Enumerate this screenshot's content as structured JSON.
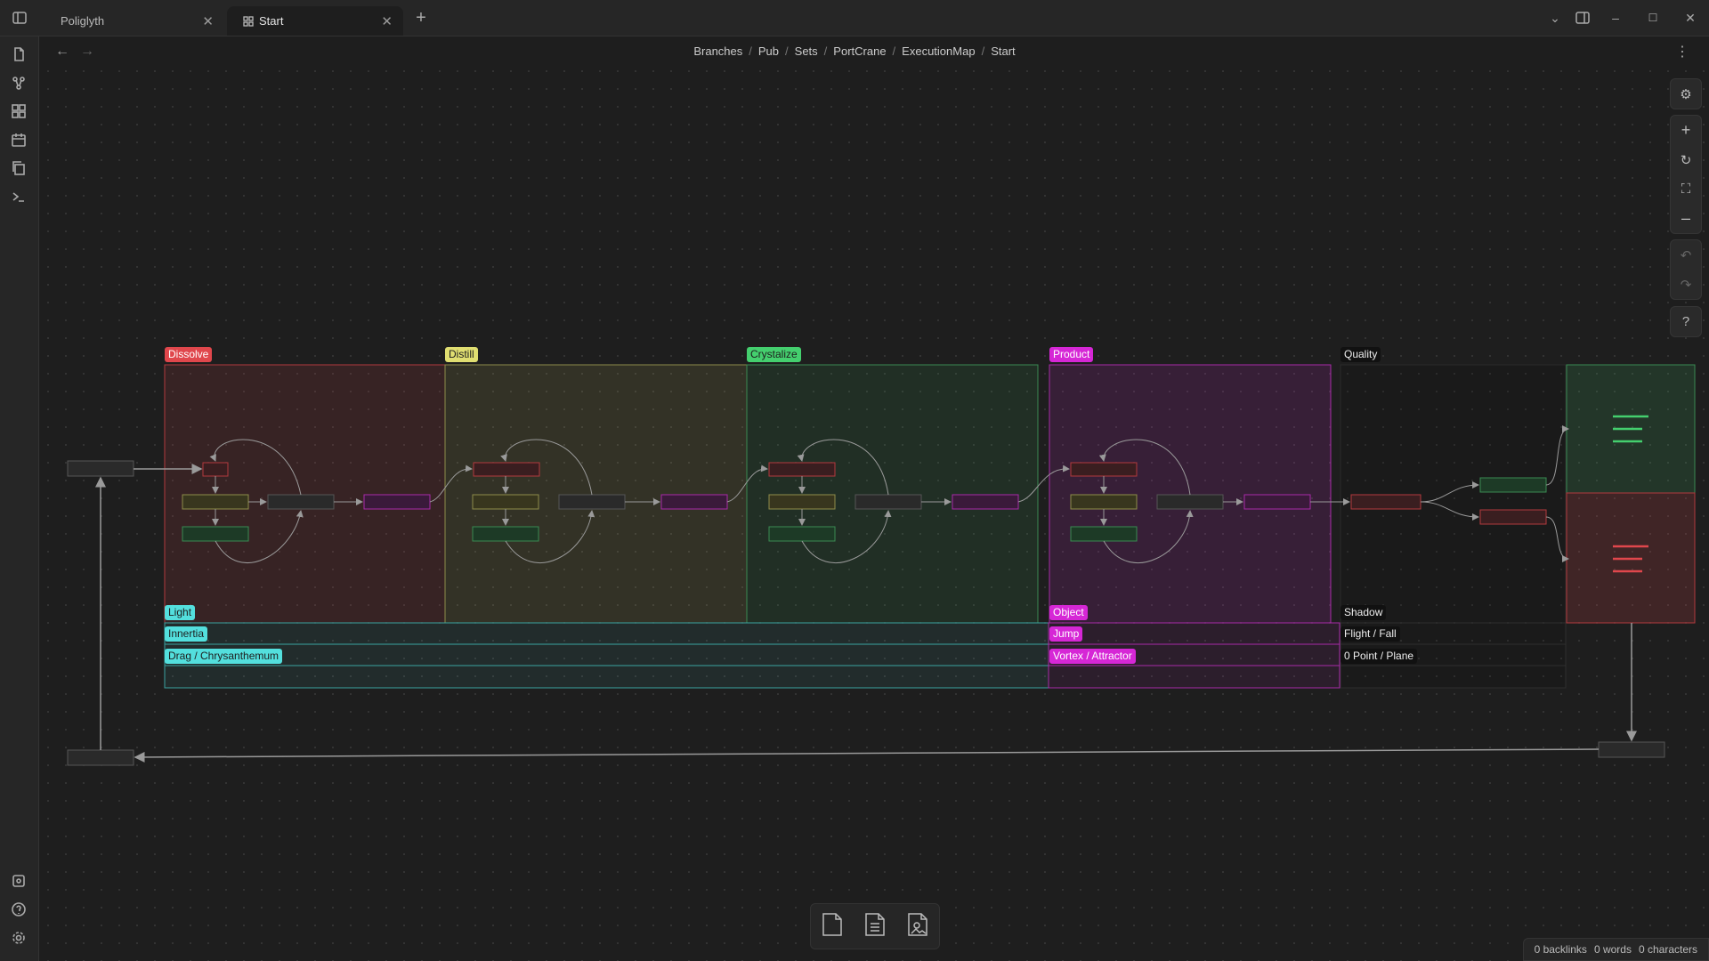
{
  "tabs": [
    {
      "label": "Poliglyth",
      "active": false
    },
    {
      "label": "Start",
      "active": true
    }
  ],
  "breadcrumb": [
    "Branches",
    "Pub",
    "Sets",
    "PortCrane",
    "ExecutionMap",
    "Start"
  ],
  "groups": {
    "dissolve": "Dissolve",
    "distill": "Distill",
    "crystalize": "Crystalize",
    "product": "Product",
    "quality": "Quality",
    "light": "Light",
    "innertia": "Innertia",
    "drag": "Drag / Chrysanthemum",
    "object": "Object",
    "jump": "Jump",
    "vortex": "Vortex / Attractor",
    "shadow": "Shadow",
    "flight": "Flight / Fall",
    "point": "0 Point / Plane"
  },
  "colors": {
    "red": "#e0474c",
    "yellow": "#e0de71",
    "green": "#44cf6e",
    "purple": "#d627d6",
    "cyan": "#53dfdd",
    "gray": "#999999"
  },
  "status": {
    "backlinks": "0 backlinks",
    "words": "0 words",
    "characters": "0 characters"
  }
}
